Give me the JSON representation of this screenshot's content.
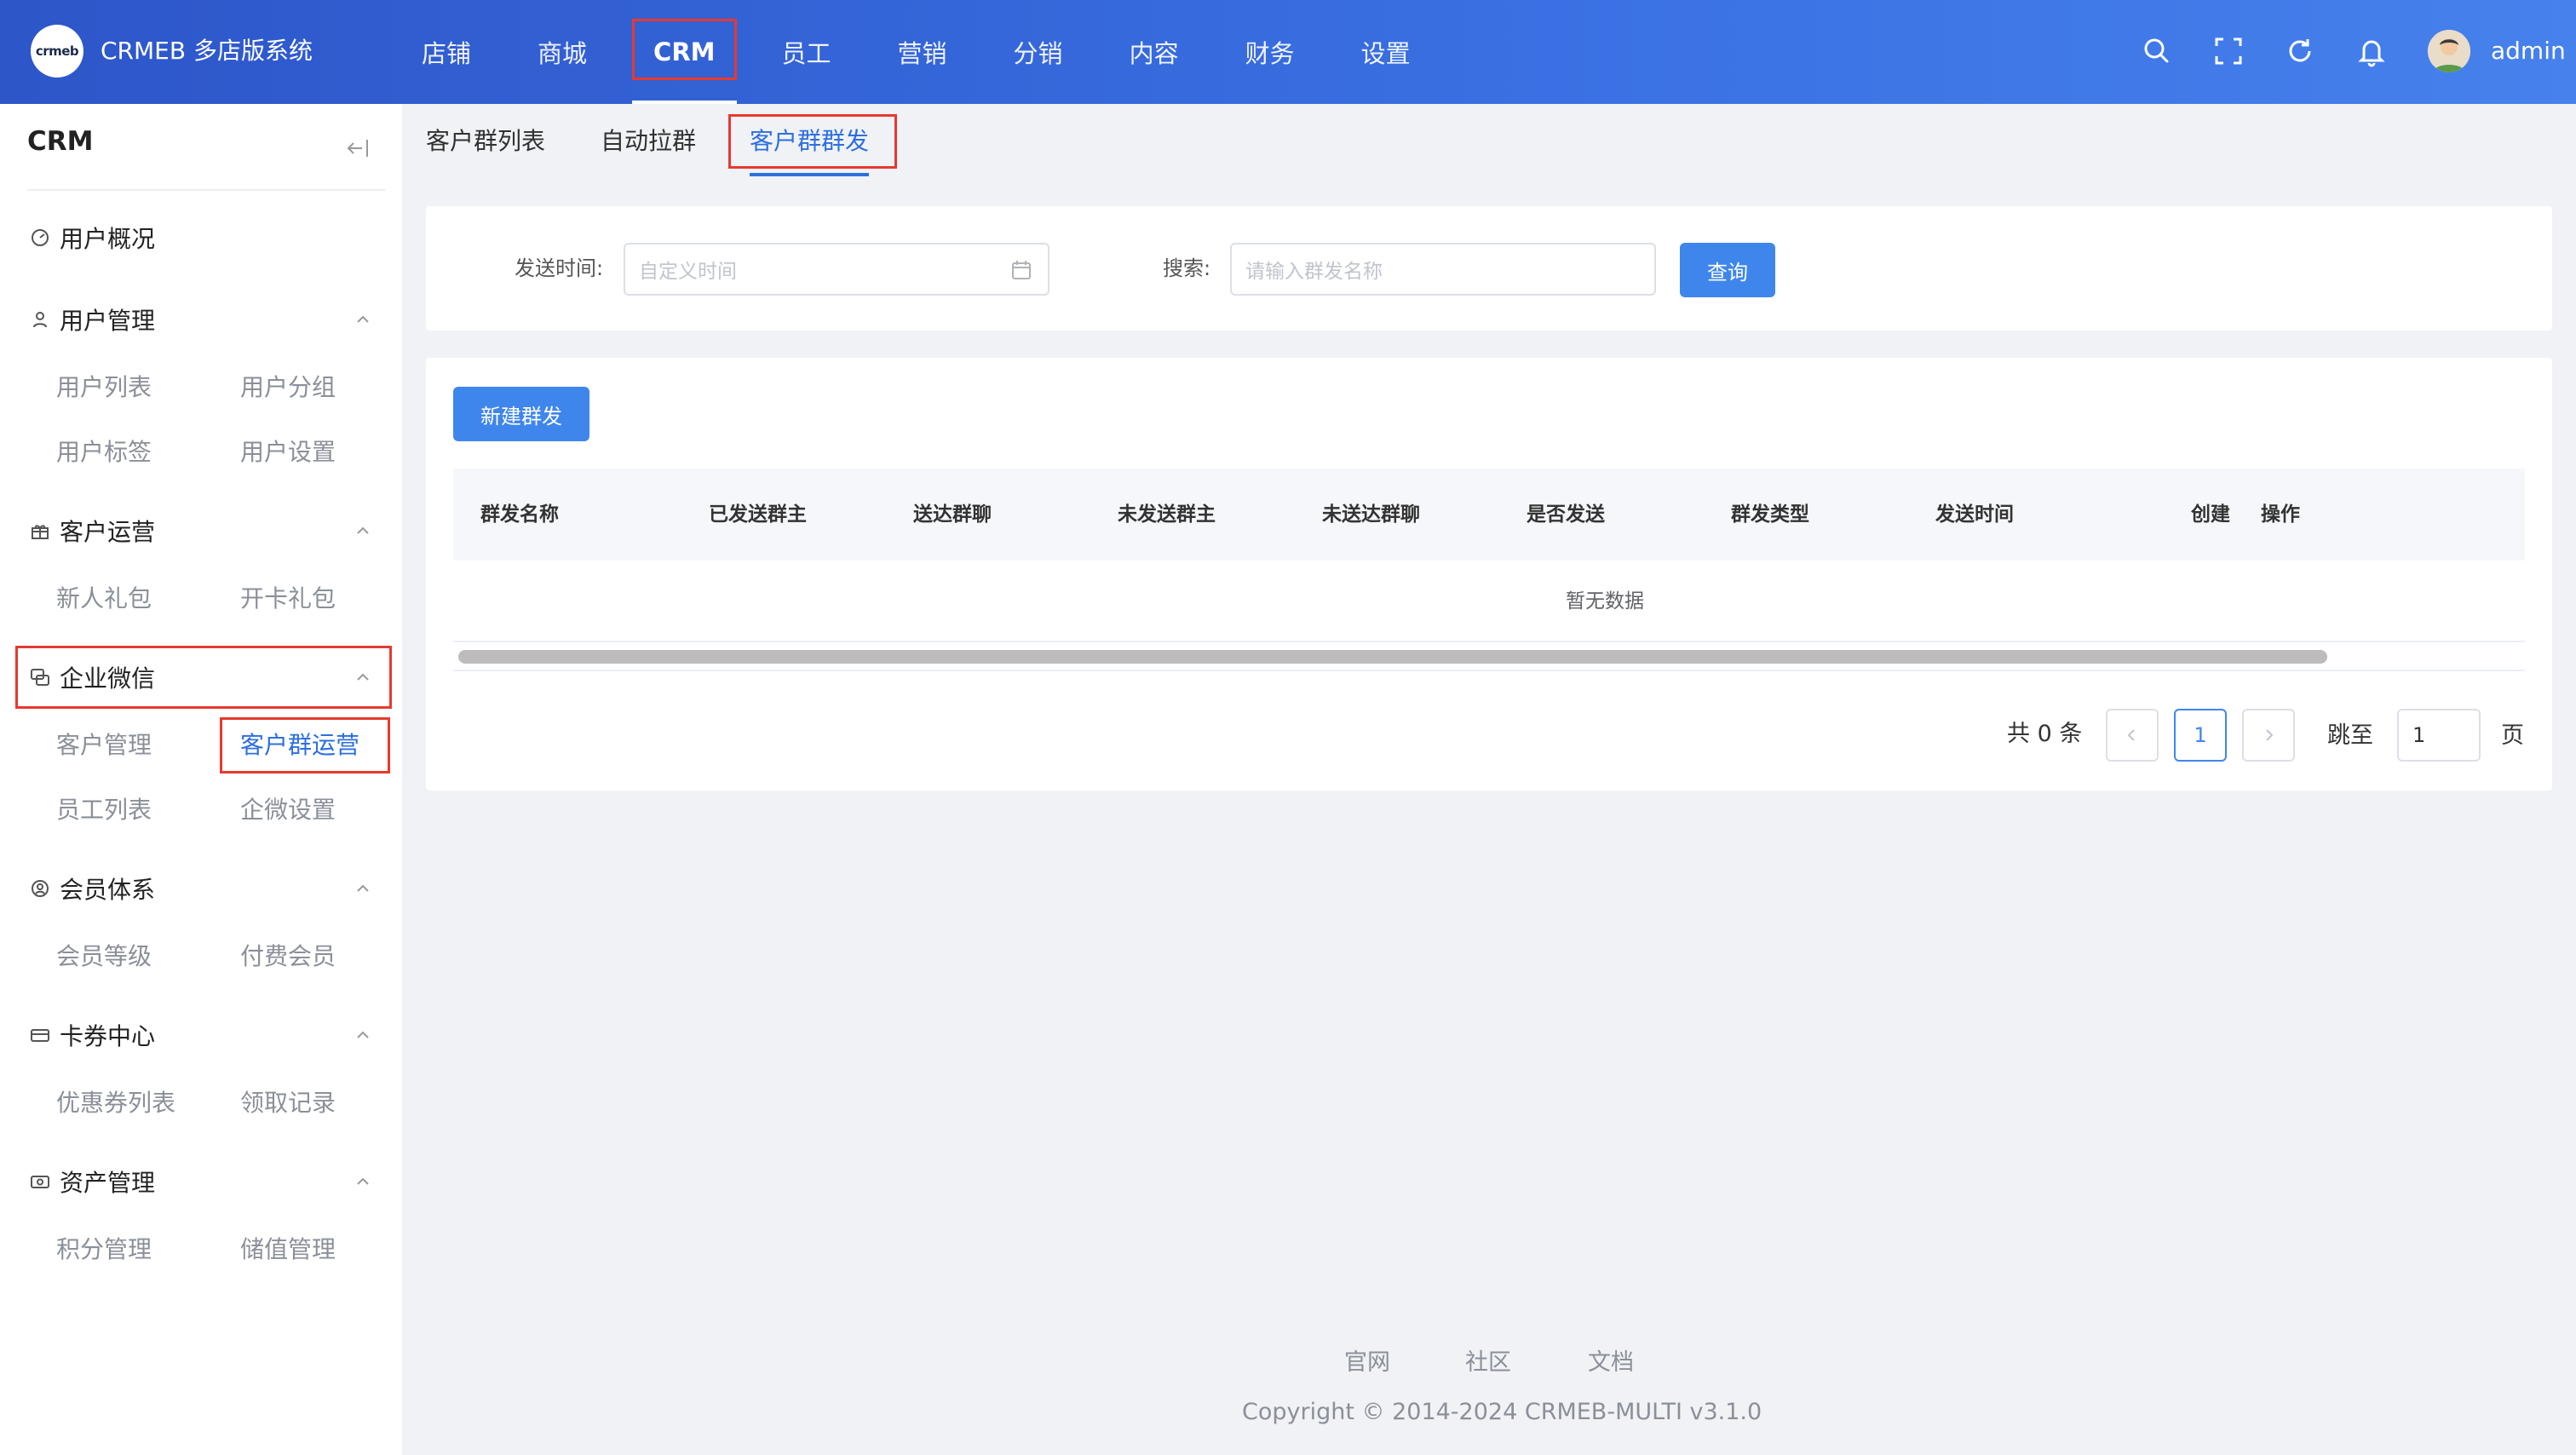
{
  "app": {
    "logo_text": "crmeb",
    "brand": "CRMEB 多店版系统"
  },
  "topnav": {
    "items": [
      {
        "label": "店铺"
      },
      {
        "label": "商城"
      },
      {
        "label": "CRM",
        "active": true
      },
      {
        "label": "员工"
      },
      {
        "label": "营销"
      },
      {
        "label": "分销"
      },
      {
        "label": "内容"
      },
      {
        "label": "财务"
      },
      {
        "label": "设置"
      }
    ],
    "username": "admin",
    "tools": [
      "search-icon",
      "fullscreen-icon",
      "refresh-icon",
      "bell-icon"
    ]
  },
  "sidebar": {
    "title": "CRM",
    "sections": [
      {
        "label": "用户概况",
        "icon": "dashboard-icon",
        "children": []
      },
      {
        "label": "用户管理",
        "icon": "user-icon",
        "children": [
          "用户列表",
          "用户分组",
          "用户标签",
          "用户设置"
        ]
      },
      {
        "label": "客户运营",
        "icon": "gift-icon",
        "children": [
          "新人礼包",
          "开卡礼包"
        ]
      },
      {
        "label": "企业微信",
        "icon": "chat-icon",
        "children": [
          "客户管理",
          "客户群运营",
          "员工列表",
          "企微设置"
        ]
      },
      {
        "label": "会员体系",
        "icon": "member-icon",
        "children": [
          "会员等级",
          "付费会员"
        ]
      },
      {
        "label": "卡券中心",
        "icon": "card-icon",
        "children": [
          "优惠券列表",
          "领取记录"
        ]
      },
      {
        "label": "资产管理",
        "icon": "wallet-icon",
        "children": [
          "积分管理",
          "储值管理"
        ]
      }
    ],
    "active_item": "客户群运营"
  },
  "tabs": [
    {
      "label": "客户群列表"
    },
    {
      "label": "自动拉群"
    },
    {
      "label": "客户群群发",
      "active": true
    }
  ],
  "filter": {
    "time_label": "发送时间:",
    "time_placeholder": "自定义时间",
    "search_label": "搜索:",
    "search_placeholder": "请输入群发名称",
    "query_button": "查询"
  },
  "table": {
    "new_button": "新建群发",
    "columns": [
      "群发名称",
      "已发送群主",
      "送达群聊",
      "未发送群主",
      "未送达群聊",
      "是否发送",
      "群发类型",
      "发送时间",
      "创建",
      "操作"
    ],
    "empty_text": "暂无数据"
  },
  "pagination": {
    "total_text": "共 0 条",
    "current_page": "1",
    "jump_label": "跳至",
    "jump_value": "1",
    "page_suffix": "页"
  },
  "footer": {
    "links": [
      "官网",
      "社区",
      "文档"
    ],
    "copyright": "Copyright © 2014-2024 CRMEB-MULTI v3.1.0"
  },
  "colors": {
    "primary": "#3f86ec",
    "header_start": "#2d56c9",
    "header_end": "#4681ec",
    "highlight_box": "#e8392f"
  }
}
